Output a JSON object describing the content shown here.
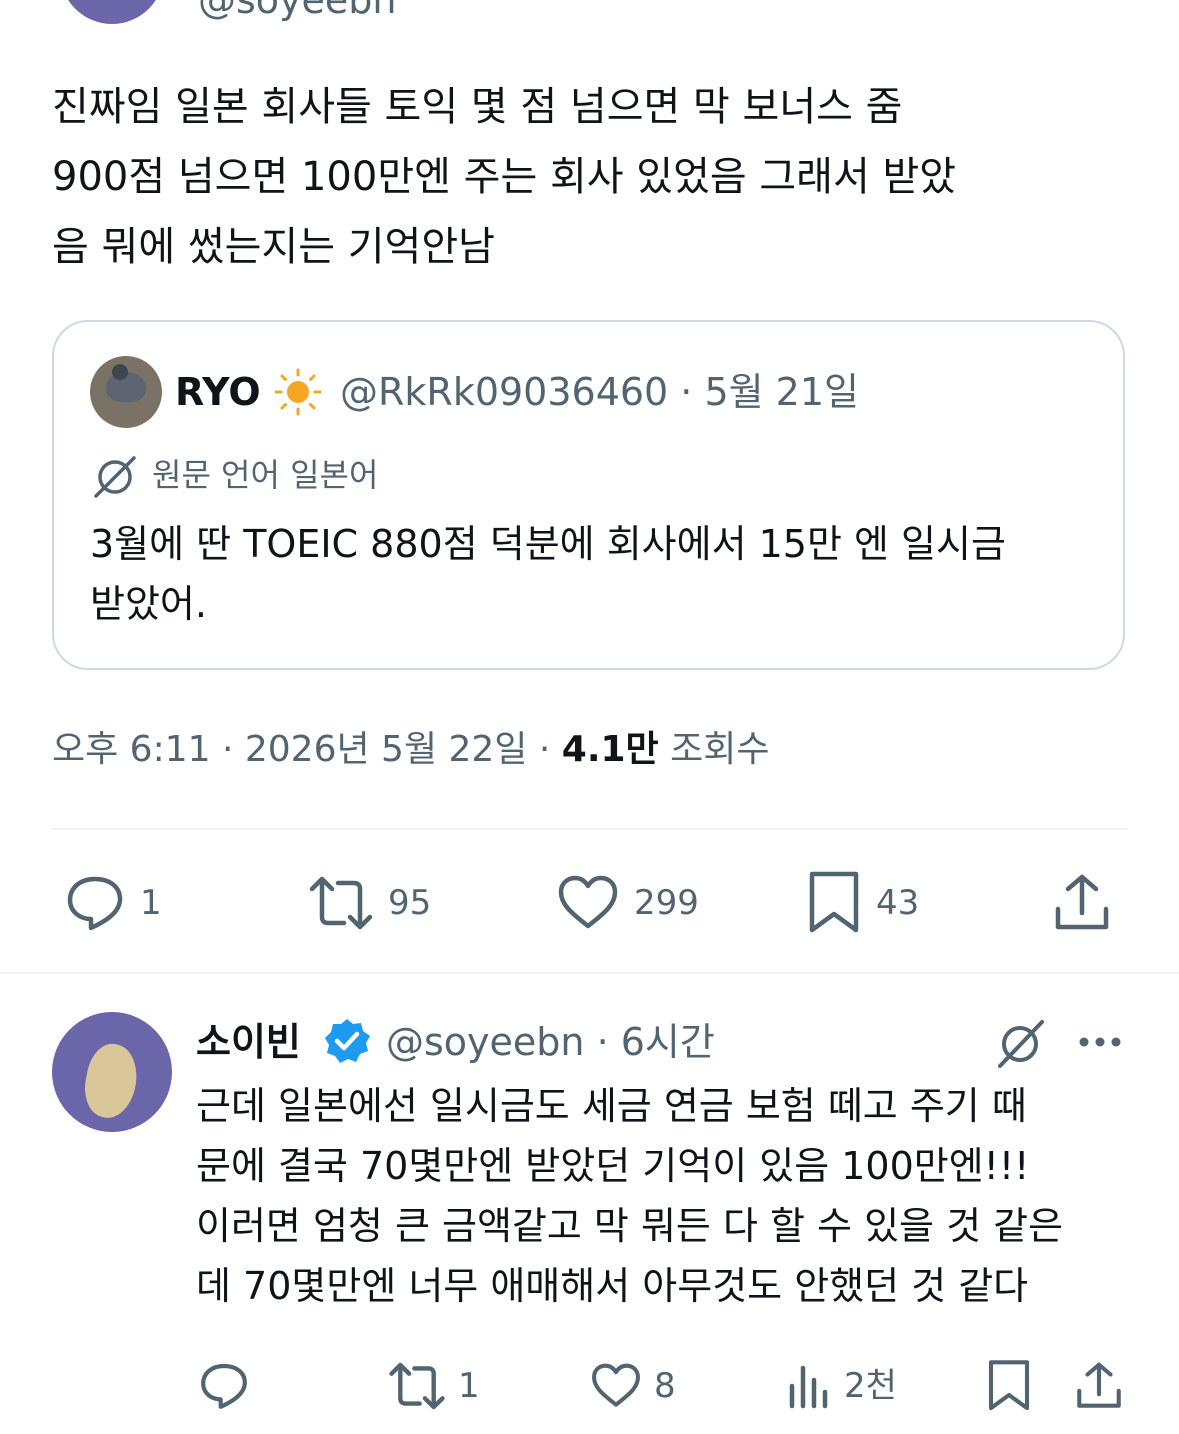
{
  "top": {
    "handle": "@soyeebn"
  },
  "main_tweet": {
    "text": "진짜임 일본 회사들 토익 몇 점 넘으면 막 보너스 줌\n900점 넘으면 100만엔 주는 회사 있었음 그래서 받았\n음 뭐에 썼는지는 기억안남",
    "time": "오후 6:11 · 2026년 5월 22일 · ",
    "views_count": "4.1만",
    "views_label": " 조회수",
    "actions": {
      "replies": "1",
      "retweets": "95",
      "likes": "299",
      "bookmarks": "43"
    }
  },
  "quote": {
    "name": "RYO",
    "name_emoji": "sun-icon",
    "meta": "@RkRk09036460 · 5월 21일",
    "translation_label": "원문 언어 일본어",
    "text": "3월에 딴 TOEIC 880점 덕분에 회사에서 15만 엔 일시금\n받았어."
  },
  "reply": {
    "name": "소이빈",
    "meta": "@soyeebn · 6시간",
    "text": "근데 일본에선 일시금도 세금 연금 보험 떼고 주기 때\n문에 결국 70몇만엔 받았던 기억이 있음 100만엔!!!\n이러면 엄청 큰 금액같고 막 뭐든 다 할 수 있을 것 같은\n데 70몇만엔 너무 애매해서 아무것도 안했던 것 같다",
    "actions": {
      "retweets": "1",
      "likes": "8",
      "views": "2천"
    }
  },
  "colors": {
    "text": "#0f1419",
    "secondary": "#536471",
    "border": "#cfd9de",
    "verified": "#1d9bf0",
    "avatar": "#6b66a9"
  }
}
